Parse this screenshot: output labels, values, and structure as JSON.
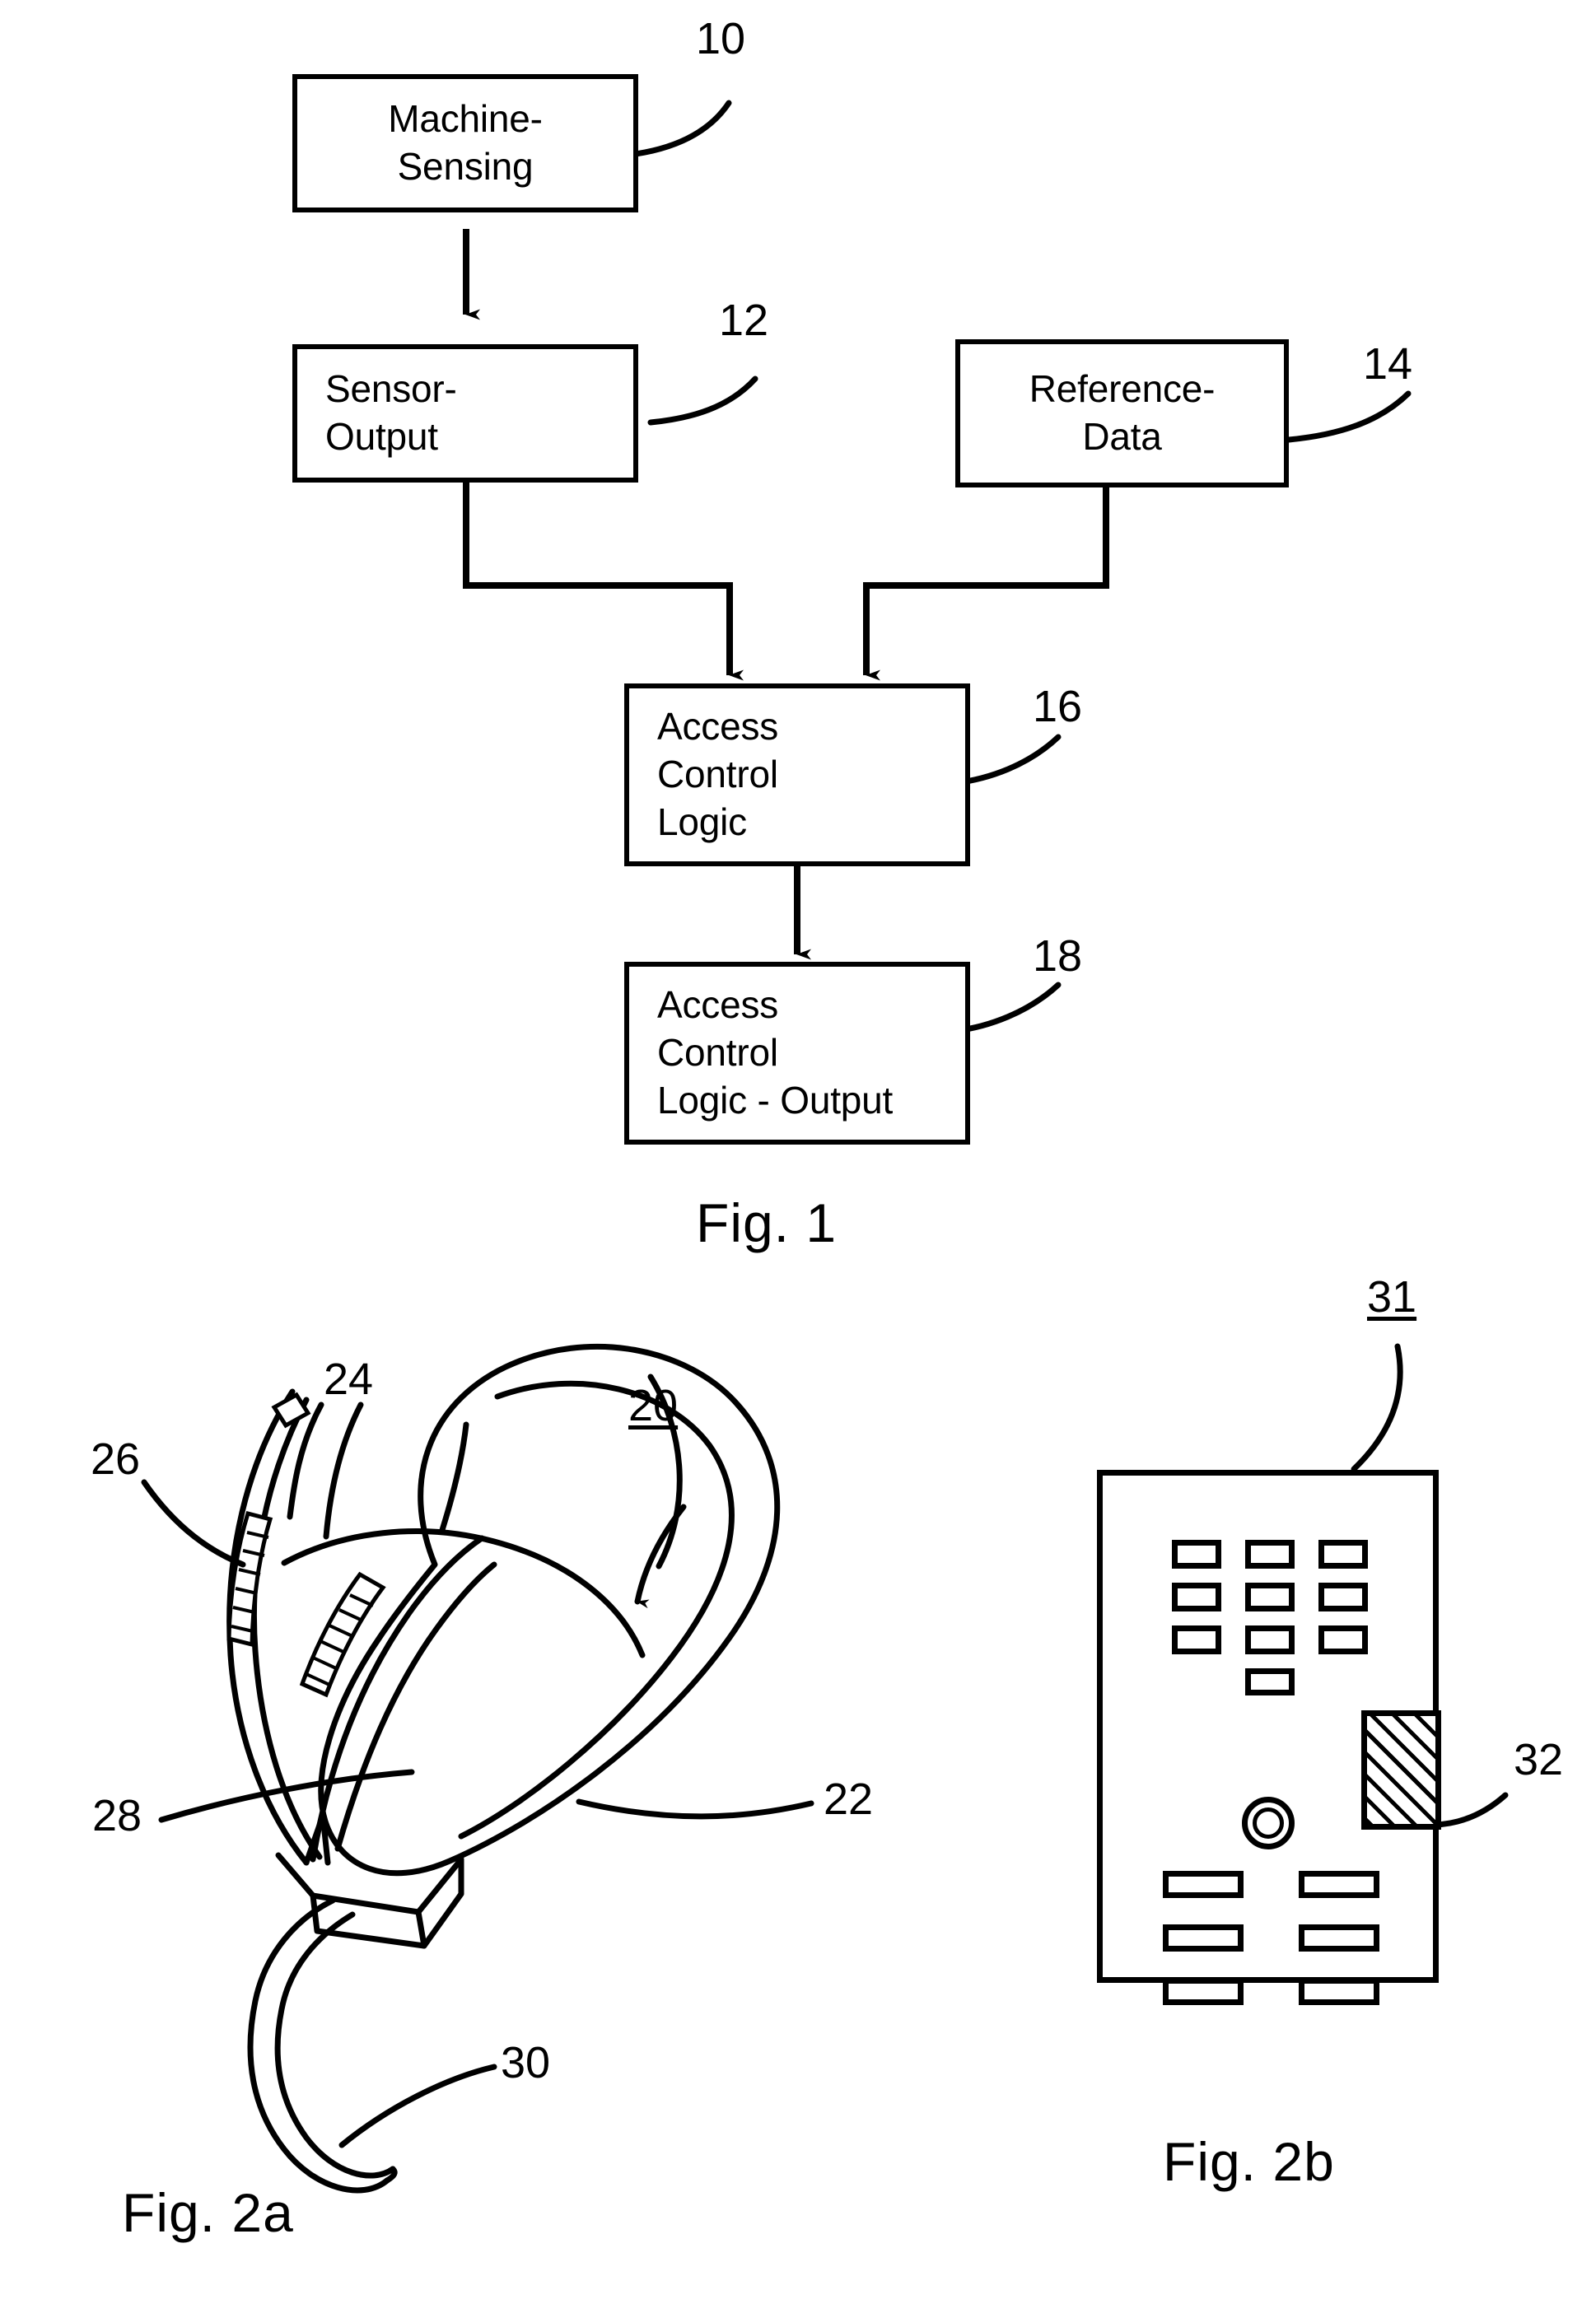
{
  "document": {
    "kind": "patent-drawing-sheet",
    "page_background": "#ffffff",
    "ink_color": "#000000"
  },
  "figures": [
    {
      "caption": "Fig. 1",
      "type": "block-flow-diagram",
      "blocks": [
        {
          "ref": "10",
          "lines": [
            "Machine-",
            "Sensing"
          ]
        },
        {
          "ref": "12",
          "lines": [
            "Sensor-",
            "Output"
          ]
        },
        {
          "ref": "14",
          "lines": [
            "Reference-",
            "Data"
          ]
        },
        {
          "ref": "16",
          "lines": [
            "Access",
            "Control",
            "Logic"
          ]
        },
        {
          "ref": "18",
          "lines": [
            "Access",
            "Control",
            "Logic - Output"
          ]
        }
      ],
      "connections": [
        {
          "from": "10",
          "to": "12",
          "style": "straight-arrow-down"
        },
        {
          "from": "12",
          "to": "16",
          "style": "elbow-arrow-down"
        },
        {
          "from": "14",
          "to": "16",
          "style": "elbow-arrow-down"
        },
        {
          "from": "16",
          "to": "18",
          "style": "straight-arrow-down"
        }
      ]
    },
    {
      "caption": "Fig. 2a",
      "type": "perspective-drawing-mouse",
      "ref_labels": [
        {
          "ref": "20",
          "underlined": true,
          "points_to": "mouse-body"
        },
        {
          "ref": "22",
          "underlined": false,
          "points_to": "mouse-top-shell"
        },
        {
          "ref": "24",
          "underlined": false,
          "points_to": "upper-sensor-tab"
        },
        {
          "ref": "26",
          "underlined": false,
          "points_to": "first-hatched-sensor-strip"
        },
        {
          "ref": "28",
          "underlined": false,
          "points_to": "second-hatched-sensor-strip"
        },
        {
          "ref": "30",
          "underlined": false,
          "points_to": "cable"
        }
      ]
    },
    {
      "caption": "Fig. 2b",
      "type": "front-view-keypad-panel",
      "ref_labels": [
        {
          "ref": "31",
          "underlined": true,
          "points_to": "keypad-panel"
        },
        {
          "ref": "32",
          "underlined": false,
          "points_to": "hatched-sensor-pad"
        }
      ],
      "keypad": {
        "grid_rows": 3,
        "grid_cols": 3,
        "extra_center_key_below_grid": 1,
        "dial_count": 1,
        "wide_keys_rows": 3,
        "wide_keys_cols": 2,
        "hatched_pad": {
          "ref": "32",
          "fill": "diagonal-hatch"
        }
      }
    }
  ]
}
